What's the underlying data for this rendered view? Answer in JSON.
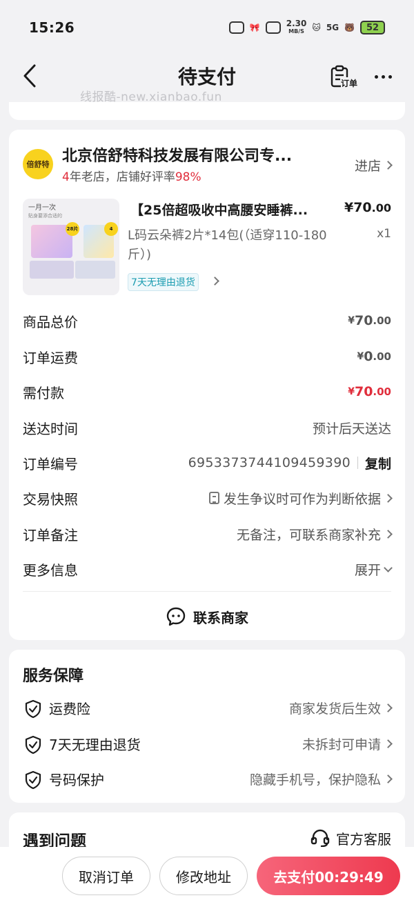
{
  "status_bar": {
    "time": "15:26",
    "speed_value": "2.30",
    "speed_unit": "MB/S",
    "network": "5G",
    "battery": "52"
  },
  "nav": {
    "title": "待支付",
    "order_label": "订单",
    "watermark": "线报酷-new.xianbao.fun"
  },
  "shop": {
    "name": "北京倍舒特科技发展有限公司专...",
    "logo_text": "倍舒特",
    "years": "4",
    "years_suffix": "年老店，店铺好评率",
    "rating": "98%",
    "enter_label": "进店"
  },
  "product": {
    "title": "【25倍超吸收中高腰安睡裤...",
    "price_int": "¥70",
    "price_dec": ".00",
    "spec": "L码云朵裤2片*14包(（适穿110-180斤）)",
    "qty": "x1",
    "return_tag": "7天无理由退货",
    "image_text_1": "一月一次",
    "image_text_2": "贴身要添合适的",
    "image_tag_a": "28片",
    "image_tag_b": "4"
  },
  "summary": {
    "goods_total_label": "商品总价",
    "goods_total_cur": "¥",
    "goods_total_int": "70",
    "goods_total_dec": ".00",
    "shipping_label": "订单运费",
    "shipping_cur": "¥",
    "shipping_int": "0",
    "shipping_dec": ".00",
    "payable_label": "需付款",
    "payable_cur": "¥",
    "payable_int": "70",
    "payable_dec": ".00",
    "delivery_label": "送达时间",
    "delivery_value": "预计后天送达",
    "order_no_label": "订单编号",
    "order_no_value": "6953373744109459390",
    "copy_label": "复制",
    "snapshot_label": "交易快照",
    "snapshot_value": "发生争议时可作为判断依据",
    "remark_label": "订单备注",
    "remark_value": "无备注，可联系商家补充",
    "more_label": "更多信息",
    "more_value": "展开"
  },
  "contact": {
    "label": "联系商家"
  },
  "service": {
    "title": "服务保障",
    "items": [
      {
        "label": "运费险",
        "value": "商家发货后生效"
      },
      {
        "label": "7天无理由退货",
        "value": "未拆封可申请"
      },
      {
        "label": "号码保护",
        "value": "隐藏手机号，保护隐私"
      }
    ]
  },
  "problem": {
    "title": "遇到问题",
    "cs_label": "官方客服"
  },
  "actions": {
    "cancel": "取消订单",
    "change_address": "修改地址",
    "pay": "去支付00:29:49"
  },
  "colors": {
    "accent_red": "#e02e3c",
    "pay_gradient_start": "#f6657a",
    "pay_gradient_end": "#ee3a4f",
    "background": "#f2f2f4",
    "tag_teal": "#1a9cb0"
  }
}
